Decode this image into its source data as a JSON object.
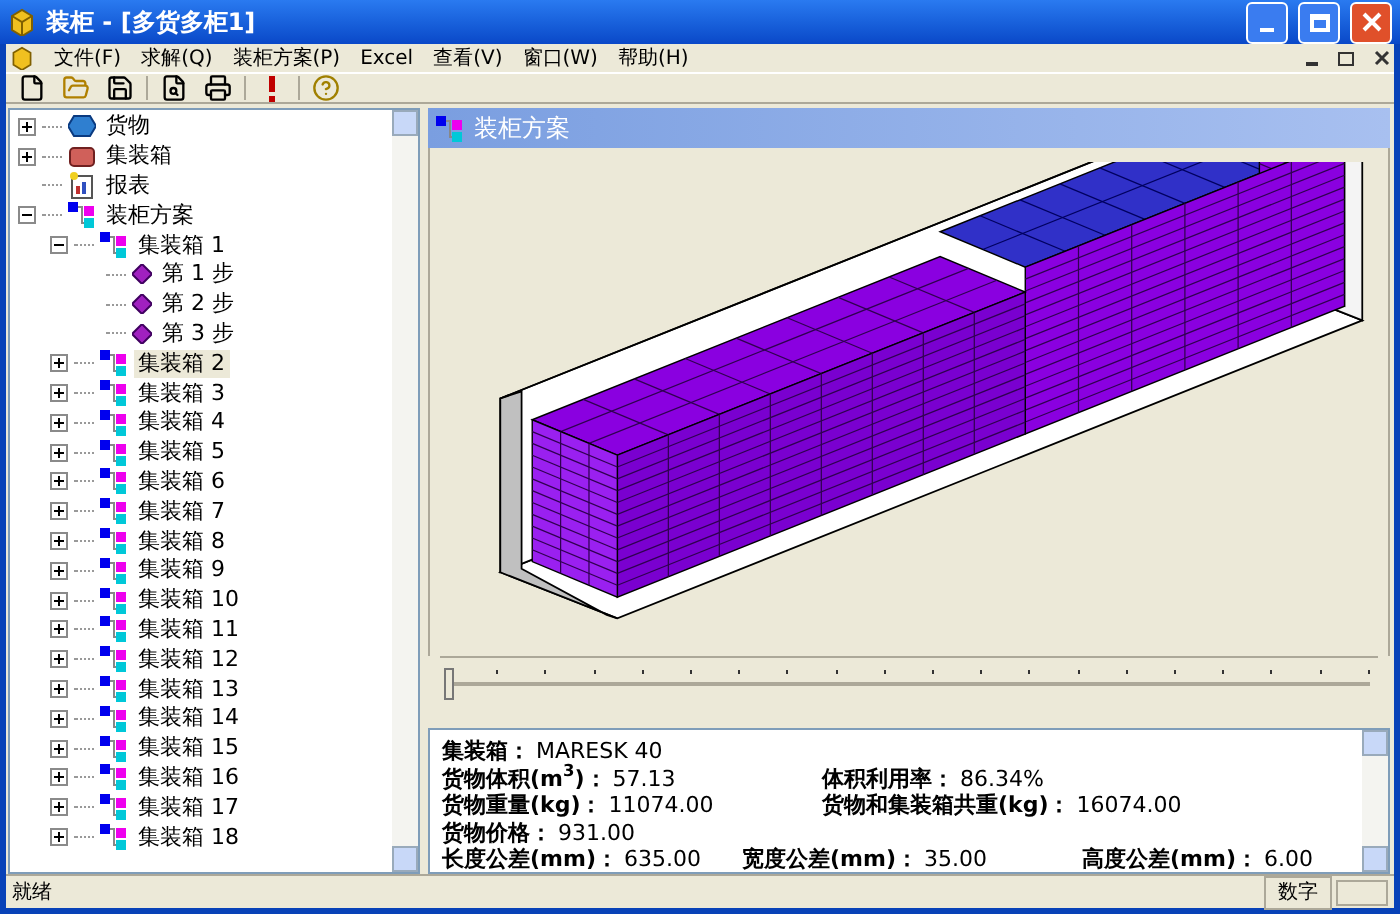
{
  "window": {
    "title": "装柜 - [多货多柜1]"
  },
  "menu": [
    "文件(F)",
    "求解(Q)",
    "装柜方案(P)",
    "Excel",
    "查看(V)",
    "窗口(W)",
    "帮助(H)"
  ],
  "tree": [
    {
      "label": "货物",
      "kind": "goods",
      "expanded": false,
      "selected": false
    },
    {
      "label": "集装箱",
      "kind": "container",
      "expanded": false,
      "selected": false
    },
    {
      "label": "报表",
      "kind": "report",
      "selected": false
    },
    {
      "label": "装柜方案",
      "kind": "plan",
      "expanded": true,
      "selected": false,
      "children": [
        {
          "label": "集装箱 1",
          "kind": "plan",
          "expanded": true,
          "selected": false,
          "children": [
            {
              "label": "第 1 步",
              "kind": "step",
              "selected": false
            },
            {
              "label": "第 2 步",
              "kind": "step",
              "selected": false
            },
            {
              "label": "第 3 步",
              "kind": "step",
              "selected": false
            }
          ]
        },
        {
          "label": "集装箱 2",
          "kind": "plan",
          "expanded": false,
          "selected": true
        },
        {
          "label": "集装箱 3",
          "kind": "plan",
          "expanded": false,
          "selected": false
        },
        {
          "label": "集装箱 4",
          "kind": "plan",
          "expanded": false,
          "selected": false
        },
        {
          "label": "集装箱 5",
          "kind": "plan",
          "expanded": false,
          "selected": false
        },
        {
          "label": "集装箱 6",
          "kind": "plan",
          "expanded": false,
          "selected": false
        },
        {
          "label": "集装箱 7",
          "kind": "plan",
          "expanded": false,
          "selected": false
        },
        {
          "label": "集装箱 8",
          "kind": "plan",
          "expanded": false,
          "selected": false
        },
        {
          "label": "集装箱 9",
          "kind": "plan",
          "expanded": false,
          "selected": false
        },
        {
          "label": "集装箱 10",
          "kind": "plan",
          "expanded": false,
          "selected": false
        },
        {
          "label": "集装箱 11",
          "kind": "plan",
          "expanded": false,
          "selected": false
        },
        {
          "label": "集装箱 12",
          "kind": "plan",
          "expanded": false,
          "selected": false
        },
        {
          "label": "集装箱 13",
          "kind": "plan",
          "expanded": false,
          "selected": false
        },
        {
          "label": "集装箱 14",
          "kind": "plan",
          "expanded": false,
          "selected": false
        },
        {
          "label": "集装箱 15",
          "kind": "plan",
          "expanded": false,
          "selected": false
        },
        {
          "label": "集装箱 16",
          "kind": "plan",
          "expanded": false,
          "selected": false
        },
        {
          "label": "集装箱 17",
          "kind": "plan",
          "expanded": false,
          "selected": false
        },
        {
          "label": "集装箱 18",
          "kind": "plan",
          "expanded": false,
          "selected": false
        }
      ]
    }
  ],
  "view": {
    "title": "装柜方案",
    "slider": {
      "level": 0
    }
  },
  "info": [
    [
      {
        "label": "集装箱：",
        "value": "MARESK 40"
      }
    ],
    [
      {
        "label": "货物体积(m$^{3}$)：",
        "value": "57.13"
      },
      {
        "label": "体积利用率：",
        "value": "86.34%"
      }
    ],
    [
      {
        "label": "货物重量(kg)：",
        "value": "11074.00"
      },
      {
        "label": "货物和集装箱共重(kg)：",
        "value": "16074.00"
      }
    ],
    [
      {
        "label": "货物价格：",
        "value": "931.00"
      }
    ],
    [
      {
        "label": "长度公差(mm)：",
        "value": "635.00"
      },
      {
        "label": "宽度公差(mm)：",
        "value": "35.00"
      },
      {
        "label": "高度公差(mm)：",
        "value": "6.00"
      }
    ]
  ],
  "status_bar": {
    "message": "就绪",
    "indicators": [
      "数字"
    ]
  }
}
